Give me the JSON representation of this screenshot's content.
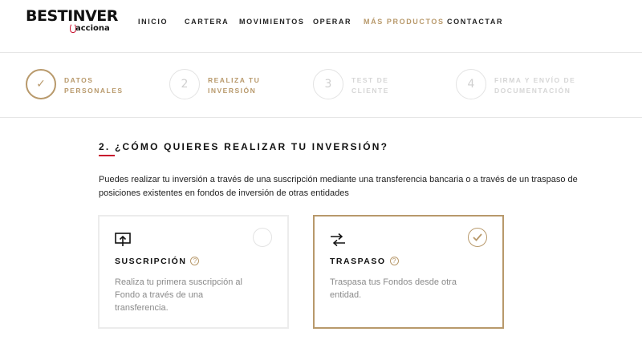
{
  "brand": {
    "name": "BESTINVER",
    "sub": "acciona"
  },
  "nav": {
    "items": [
      {
        "label": "INICIO"
      },
      {
        "label": "CARTERA"
      },
      {
        "label": "MOVIMIENTOS"
      },
      {
        "label": "OPERAR"
      },
      {
        "label": "MÁS PRODUCTOS"
      },
      {
        "label": "CONTACTAR"
      }
    ],
    "active": "MÁS PRODUCTOS"
  },
  "stepper": {
    "steps": [
      {
        "number": "✓",
        "line1": "DATOS",
        "line2": "PERSONALES",
        "state": "done"
      },
      {
        "number": "2",
        "line1": "REALIZA TU",
        "line2": "INVERSIÓN",
        "state": "current"
      },
      {
        "number": "3",
        "line1": "TEST DE",
        "line2": "CLIENTE",
        "state": "pending"
      },
      {
        "number": "4",
        "line1": "FIRMA Y ENVÍO DE",
        "line2": "DOCUMENTACIÓN",
        "state": "pending"
      }
    ]
  },
  "main": {
    "title": "2. ¿CÓMO QUIERES REALIZAR TU INVERSIÓN?",
    "intro": "Puedes realizar tu inversión a través de una suscripción mediante una transferencia bancaria o a través de un traspaso de posiciones existentes en fondos de inversión de otras entidades",
    "options": [
      {
        "icon": "upload-screen-icon",
        "title": "SUSCRIPCIÓN",
        "help": "?",
        "description": "Realiza tu primera suscripción al Fondo a través de una transferencia.",
        "selected": false
      },
      {
        "icon": "transfer-arrows-icon",
        "title": "TRASPASO",
        "help": "?",
        "description": "Traspasa tus Fondos desde otra entidad.",
        "selected": true
      }
    ]
  },
  "colors": {
    "accent": "#b8996b",
    "brand_red": "#c8102e"
  }
}
